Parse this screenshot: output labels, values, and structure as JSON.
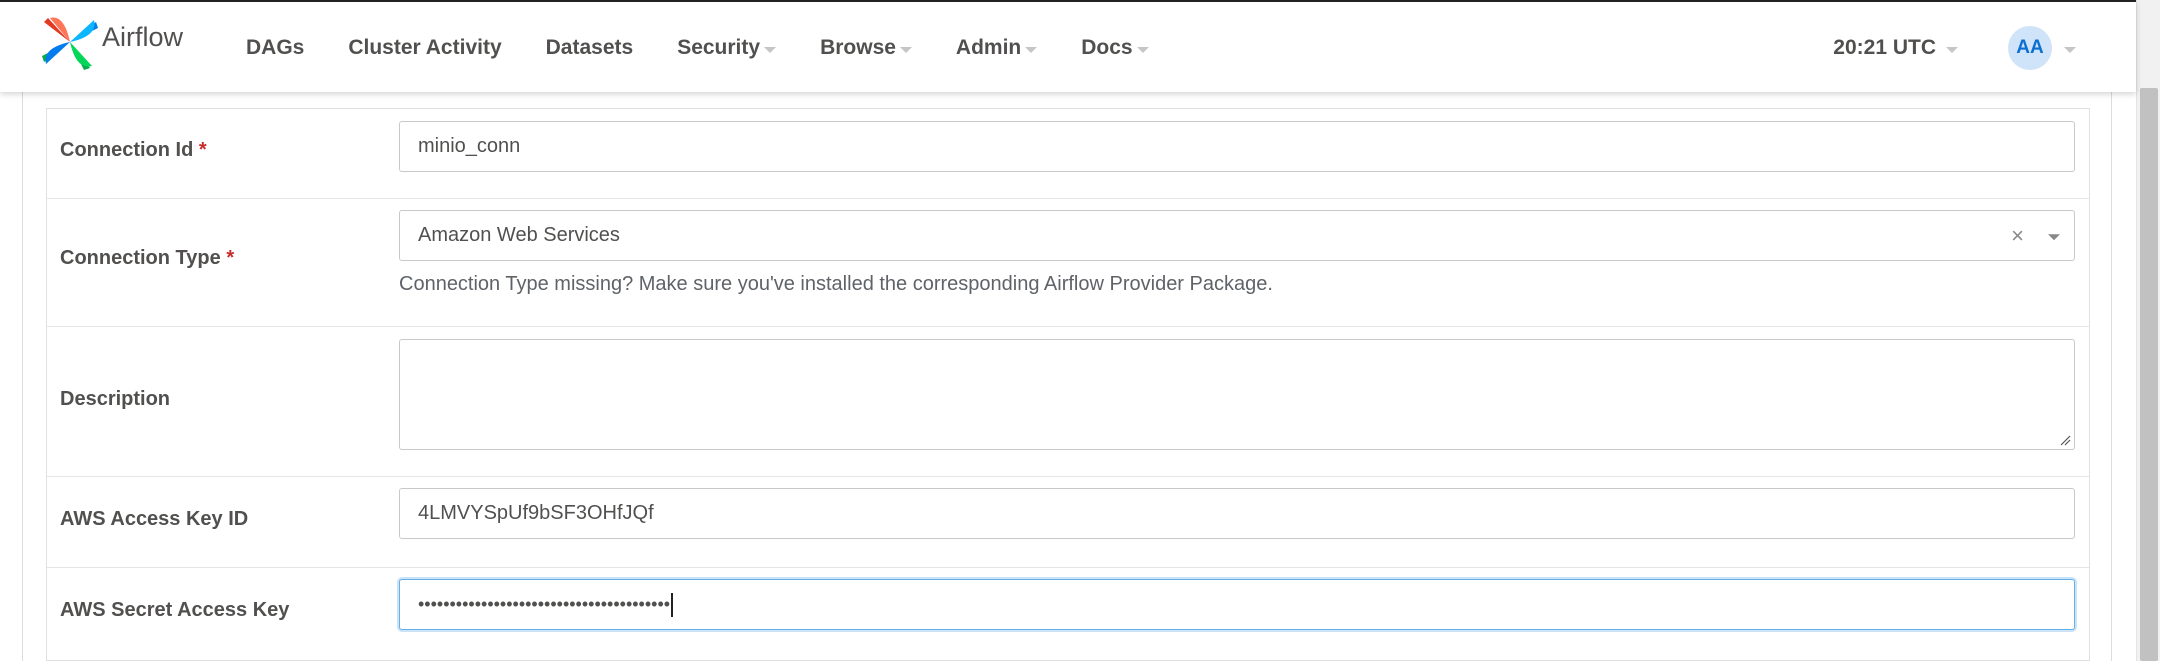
{
  "brand": {
    "name": "Airflow"
  },
  "nav": {
    "items": [
      {
        "label": "DAGs",
        "dropdown": false
      },
      {
        "label": "Cluster Activity",
        "dropdown": false
      },
      {
        "label": "Datasets",
        "dropdown": false
      },
      {
        "label": "Security",
        "dropdown": true
      },
      {
        "label": "Browse",
        "dropdown": true
      },
      {
        "label": "Admin",
        "dropdown": true
      },
      {
        "label": "Docs",
        "dropdown": true
      }
    ],
    "time": "20:21 UTC",
    "user_initials": "AA"
  },
  "form": {
    "connection_id": {
      "label": "Connection Id",
      "required_mark": "*",
      "value": "minio_conn"
    },
    "connection_type": {
      "label": "Connection Type",
      "required_mark": "*",
      "value": "Amazon Web Services",
      "clear_symbol": "×",
      "hint": "Connection Type missing? Make sure you've installed the corresponding Airflow Provider Package."
    },
    "description": {
      "label": "Description",
      "value": ""
    },
    "aws_access_key_id": {
      "label": "AWS Access Key ID",
      "value": "4LMVYSpUf9bSF3OHfJQf"
    },
    "aws_secret_access_key": {
      "label": "AWS Secret Access Key",
      "value": "••••••••••••••••••••••••••••••••••••••••"
    }
  },
  "colors": {
    "accent_red": "#c72c2c",
    "avatar_bg": "#cfe4f8",
    "avatar_text": "#0d6fd1",
    "focus_border": "#66afe9"
  }
}
